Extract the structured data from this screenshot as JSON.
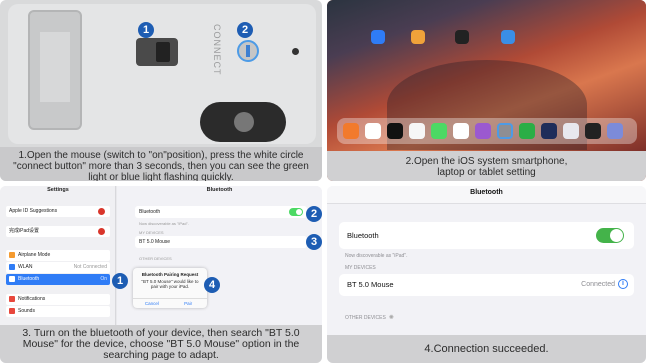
{
  "steps": [
    {
      "id": 1,
      "caption": "1.Open the mouse (switch to \"on\"position), press the white circle \"connect button\" more than 3 seconds, then you can see the green light or blue light flashing quickly.",
      "device": {
        "vertical_text": "CONNECT",
        "badges": [
          "1",
          "2"
        ]
      }
    },
    {
      "id": 2,
      "caption_line1": "2.Open the iOS system smartphone,",
      "caption_line2": "laptop or tablet setting"
    },
    {
      "id": 3,
      "caption": "3.  Turn on the bluetooth of your device, then search \"BT 5.0 Mouse\" for the device, choose \"BT 5.0 Mouse\" option in the searching page to adapt.",
      "sidebar": {
        "title": "Settings",
        "items": [
          {
            "label": "Apple ID Suggestions",
            "right": "",
            "icon_color": "#ffffff",
            "badge": true
          },
          {
            "label": "完成iPad设置",
            "right": "",
            "icon_color": "#ffffff",
            "badge": true
          },
          {
            "label": "Airplane Mode",
            "right": "",
            "icon_color": "#f59b30",
            "badge": false
          },
          {
            "label": "WLAN",
            "right": "Not Connected",
            "icon_color": "#2f7cf6",
            "badge": false
          },
          {
            "label": "Bluetooth",
            "right": "On",
            "icon_color": "#2f7cf6",
            "badge": false,
            "selected": true
          },
          {
            "label": "Notifications",
            "right": "",
            "icon_color": "#e8473c",
            "badge": false
          },
          {
            "label": "Sounds",
            "right": "",
            "icon_color": "#e8473c",
            "badge": false
          }
        ]
      },
      "main": {
        "title": "Bluetooth",
        "bluetooth_label": "Bluetooth",
        "discoverable": "Now discoverable as \"iPad\".",
        "my_devices": "MY DEVICES",
        "device_name": "BT 5.0 Mouse",
        "other_devices": "OTHER DEVICES"
      },
      "alert": {
        "title": "Bluetooth Pairing Request",
        "body": "\"BT 5.0 Mouse\" would like to pair with your iPad.",
        "cancel": "Cancel",
        "pair": "Pair"
      },
      "badges": [
        "1",
        "2",
        "3",
        "4"
      ]
    },
    {
      "id": 4,
      "caption": "4.Connection succeeded.",
      "screen": {
        "title": "Bluetooth",
        "bluetooth_label": "Bluetooth",
        "discoverable": "Now discoverable as \"iPad\".",
        "my_devices": "MY DEVICES",
        "device_name": "BT 5.0 Mouse",
        "device_status": "Connected",
        "other_devices": "OTHER DEVICES"
      }
    }
  ],
  "colors": {
    "badge": "#1e5db3",
    "toggle_on": "#44b34a",
    "ios_blue": "#2f7cf6"
  }
}
